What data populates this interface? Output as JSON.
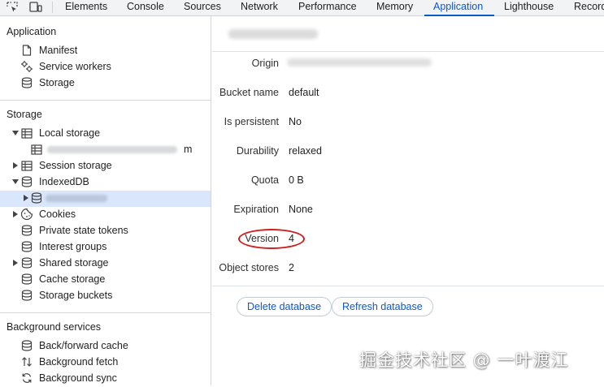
{
  "tabs": [
    {
      "label": "Elements",
      "active": false
    },
    {
      "label": "Console",
      "active": false
    },
    {
      "label": "Sources",
      "active": false
    },
    {
      "label": "Network",
      "active": false
    },
    {
      "label": "Performance",
      "active": false
    },
    {
      "label": "Memory",
      "active": false
    },
    {
      "label": "Application",
      "active": true
    },
    {
      "label": "Lighthouse",
      "active": false
    },
    {
      "label": "Recorder",
      "active": false
    }
  ],
  "sidebar": {
    "application": {
      "title": "Application",
      "items": [
        {
          "label": "Manifest",
          "icon": "file-icon"
        },
        {
          "label": "Service workers",
          "icon": "gears-icon"
        },
        {
          "label": "Storage",
          "icon": "database-icon"
        }
      ]
    },
    "storage": {
      "title": "Storage",
      "items": [
        {
          "label": "Local storage",
          "icon": "table-icon",
          "expanded": true
        },
        {
          "label": "m",
          "icon": "table-icon",
          "blurred": true
        },
        {
          "label": "Session storage",
          "icon": "table-icon",
          "expanded": false
        },
        {
          "label": "IndexedDB",
          "icon": "database-icon",
          "expanded": true
        },
        {
          "label": "",
          "icon": "database-icon",
          "blurred": true,
          "selected": true
        },
        {
          "label": "Cookies",
          "icon": "cookie-icon",
          "expanded": false
        },
        {
          "label": "Private state tokens",
          "icon": "database-icon"
        },
        {
          "label": "Interest groups",
          "icon": "database-icon"
        },
        {
          "label": "Shared storage",
          "icon": "database-icon",
          "expanded": false
        },
        {
          "label": "Cache storage",
          "icon": "database-icon"
        },
        {
          "label": "Storage buckets",
          "icon": "database-icon"
        }
      ]
    },
    "background": {
      "title": "Background services",
      "items": [
        {
          "label": "Back/forward cache",
          "icon": "database-icon"
        },
        {
          "label": "Background fetch",
          "icon": "arrows-updown-icon"
        },
        {
          "label": "Background sync",
          "icon": "sync-icon"
        }
      ]
    }
  },
  "database": {
    "properties": [
      {
        "label": "Origin",
        "value": ""
      },
      {
        "label": "Bucket name",
        "value": "default"
      },
      {
        "label": "Is persistent",
        "value": "No"
      },
      {
        "label": "Durability",
        "value": "relaxed"
      },
      {
        "label": "Quota",
        "value": "0 B"
      },
      {
        "label": "Expiration",
        "value": "None"
      },
      {
        "label": "Version",
        "value": "4"
      },
      {
        "label": "Object stores",
        "value": "2"
      }
    ],
    "delete_label": "Delete database",
    "refresh_label": "Refresh database"
  },
  "watermark": "掘金技术社区 @ 一叶渡江",
  "colors": {
    "accent": "#0b57d0",
    "selected_row": "#d9e6fb",
    "highlight_oval": "#d11f1f"
  }
}
